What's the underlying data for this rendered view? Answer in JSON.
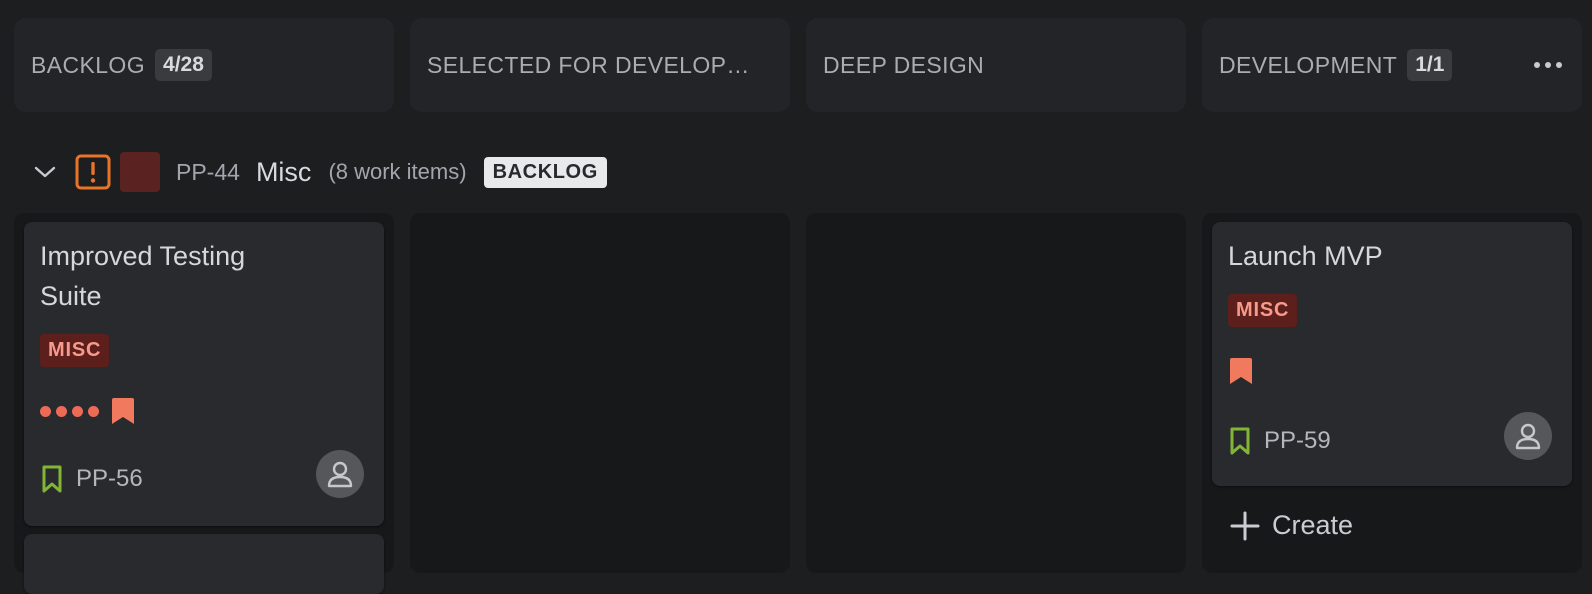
{
  "columns": [
    {
      "title": "BACKLOG",
      "count": "4/28"
    },
    {
      "title": "SELECTED FOR DEVELOPMENT"
    },
    {
      "title": "DEEP DESIGN"
    },
    {
      "title": "DEVELOPMENT",
      "count": "1/1"
    }
  ],
  "group": {
    "key": "PP-44",
    "name": "Misc",
    "count_text": "(8 work items)",
    "status": "BACKLOG",
    "swatch_color": "#5a2220"
  },
  "cards": [
    {
      "title": "Improved Testing Suite",
      "label": "MISC",
      "key": "PP-56",
      "priority_dots": 4,
      "priority_icon": "priority-flag-icon",
      "type_icon": "story-bookmark-icon"
    },
    {
      "title": "Launch MVP",
      "label": "MISC",
      "key": "PP-59",
      "priority_icon": "priority-flag-icon",
      "type_icon": "story-bookmark-icon"
    }
  ],
  "create_label": "Create",
  "colors": {
    "background": "#1d1e20",
    "column_header": "#232427",
    "column_body": "#17181a",
    "card": "#292a2e",
    "label_bg": "#5c1f1c",
    "label_text": "#f79a8c",
    "accent_orange": "#e8742a",
    "story_green": "#82b536",
    "priority_red": "#ee6a57"
  }
}
